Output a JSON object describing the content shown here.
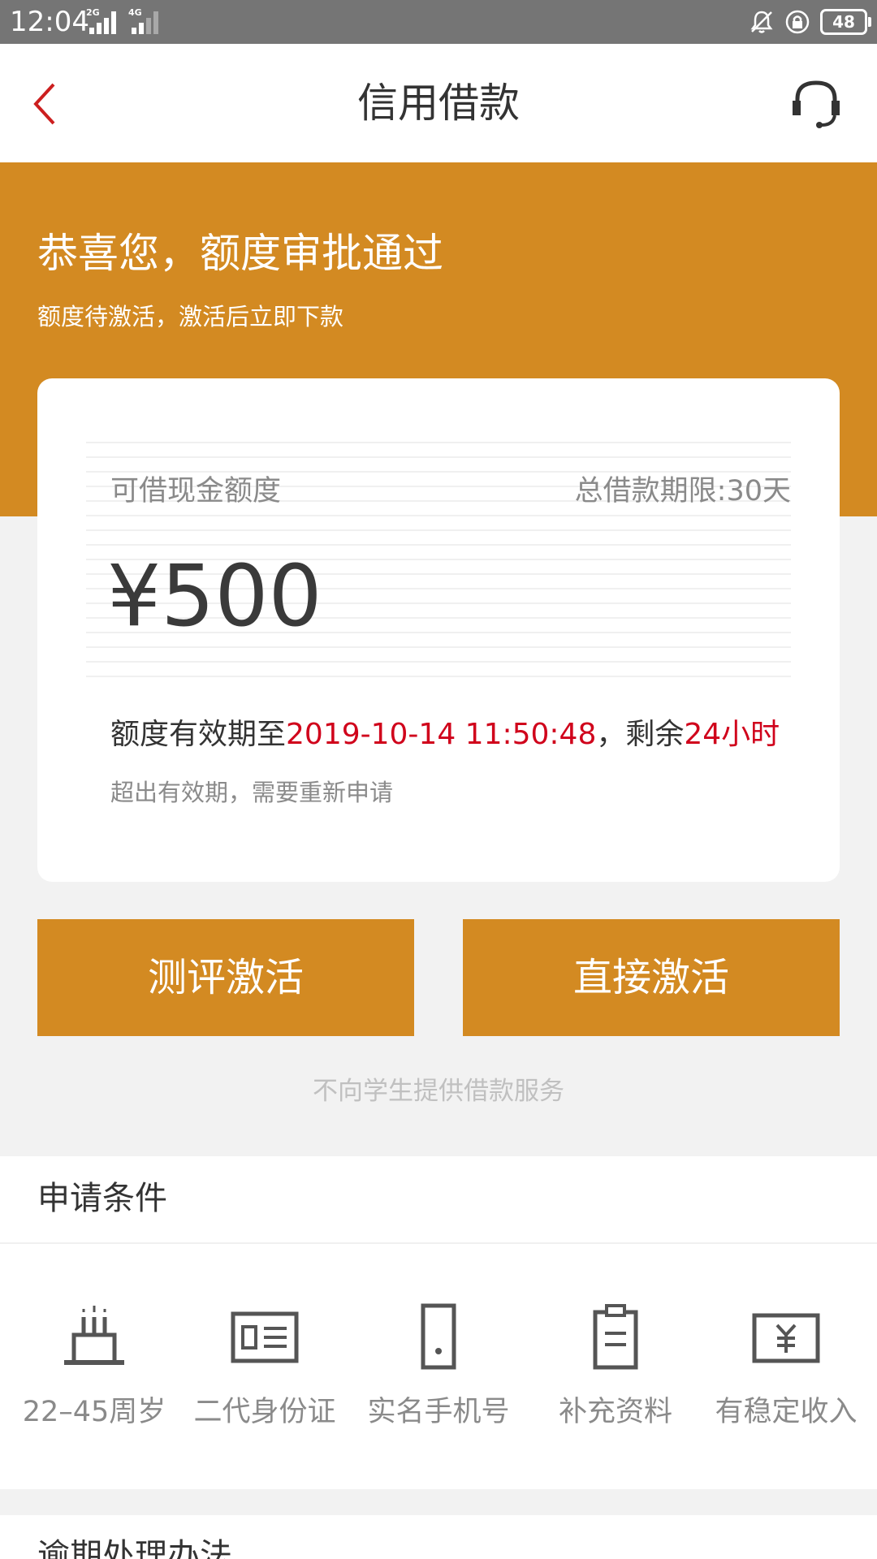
{
  "status_bar": {
    "time": "12:04",
    "network_1": "2G",
    "network_2": "4G",
    "battery": "48"
  },
  "header": {
    "title": "信用借款"
  },
  "banner": {
    "headline": "恭喜您，额度审批通过",
    "subline": "额度待激活，激活后立即下款"
  },
  "credit_card": {
    "label": "可借现金额度",
    "term": "总借款期限:30天",
    "amount": "¥500",
    "validity_prefix": "额度有效期至",
    "validity_date": "2019-10-14 11:50:48",
    "validity_mid": "，剩余",
    "remaining": "24小时",
    "note": "超出有效期，需要重新申请"
  },
  "buttons": {
    "evaluate_activate": "测评激活",
    "direct_activate": "直接激活"
  },
  "disclaimer": "不向学生提供借款服务",
  "conditions": {
    "title": "申请条件",
    "items": [
      {
        "label": "22–45周岁",
        "icon": "birthday-cake-icon"
      },
      {
        "label": "二代身份证",
        "icon": "id-card-icon"
      },
      {
        "label": "实名手机号",
        "icon": "mobile-phone-icon"
      },
      {
        "label": "补充资料",
        "icon": "clipboard-icon"
      },
      {
        "label": "有稳定收入",
        "icon": "income-icon"
      }
    ]
  },
  "overdue": {
    "title": "逾期处理办法"
  },
  "colors": {
    "accent": "#d38a22",
    "highlight_red": "#d0021b",
    "status_bar": "#757575"
  }
}
